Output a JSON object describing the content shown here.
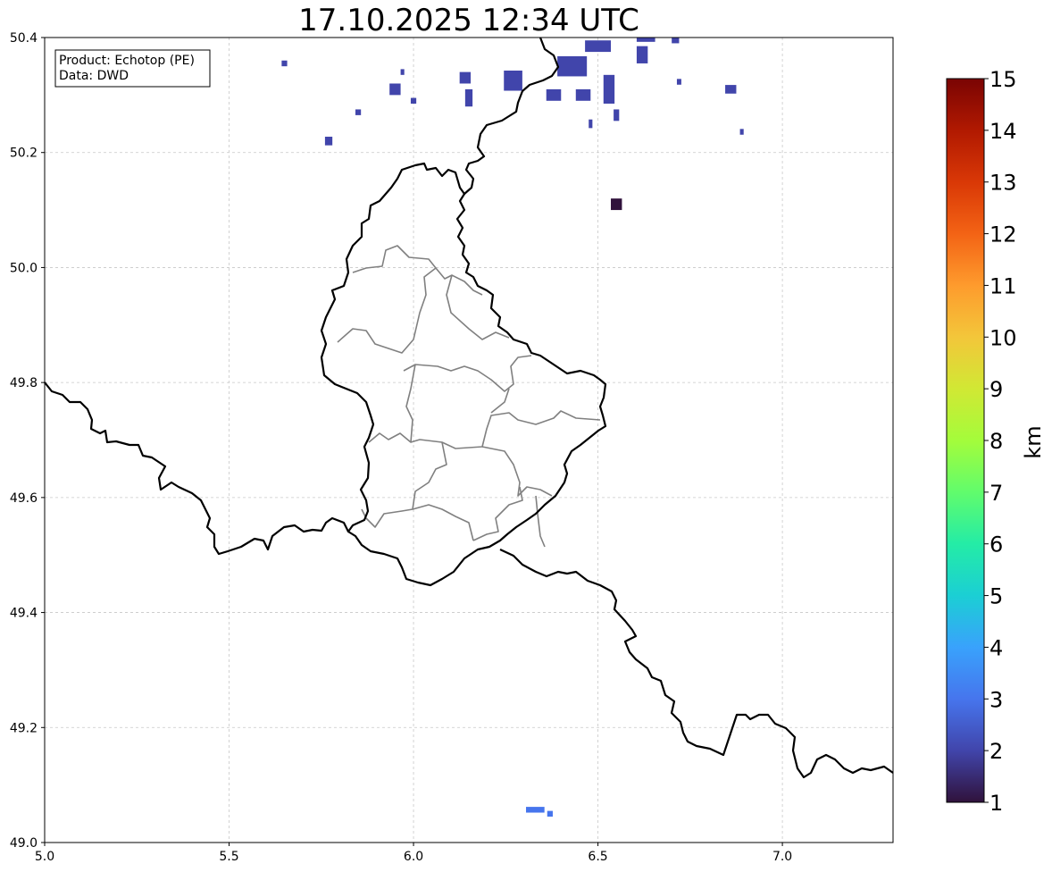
{
  "title": "17.10.2025 12:34 UTC",
  "info_box": {
    "product_line": "Product: Echotop (PE)",
    "data_line": "Data: DWD"
  },
  "map": {
    "lon_range": [
      5.0,
      7.3
    ],
    "lat_range": [
      49.0,
      50.4
    ],
    "x_ticks": [
      {
        "value": 5.0,
        "label": "5.0"
      },
      {
        "value": 5.5,
        "label": "5.5"
      },
      {
        "value": 6.0,
        "label": "6.0"
      },
      {
        "value": 6.5,
        "label": "6.5"
      },
      {
        "value": 7.0,
        "label": "7.0"
      }
    ],
    "y_ticks": [
      {
        "value": 49.0,
        "label": "49.0"
      },
      {
        "value": 49.2,
        "label": "49.2"
      },
      {
        "value": 49.4,
        "label": "49.4"
      },
      {
        "value": 49.6,
        "label": "49.6"
      },
      {
        "value": 49.8,
        "label": "49.8"
      },
      {
        "value": 50.0,
        "label": "50.0"
      },
      {
        "value": 50.2,
        "label": "50.2"
      },
      {
        "value": 50.4,
        "label": "50.4"
      }
    ],
    "grid": true,
    "colors": {
      "border": "#000000",
      "districts": "#808080",
      "grid": "#c8c8c8"
    },
    "radar_cells": [
      {
        "lon": 5.65,
        "lat": 50.355,
        "w": 0.015,
        "h": 0.01,
        "km": 2.3
      },
      {
        "lon": 5.77,
        "lat": 50.22,
        "w": 0.02,
        "h": 0.015,
        "km": 2.2
      },
      {
        "lon": 5.85,
        "lat": 50.27,
        "w": 0.015,
        "h": 0.01,
        "km": 2.2
      },
      {
        "lon": 5.95,
        "lat": 50.31,
        "w": 0.03,
        "h": 0.02,
        "km": 2.2
      },
      {
        "lon": 5.97,
        "lat": 50.34,
        "w": 0.01,
        "h": 0.01,
        "km": 2.0
      },
      {
        "lon": 6.0,
        "lat": 50.29,
        "w": 0.015,
        "h": 0.01,
        "km": 2.3
      },
      {
        "lon": 6.14,
        "lat": 50.33,
        "w": 0.03,
        "h": 0.02,
        "km": 2.1
      },
      {
        "lon": 6.15,
        "lat": 50.295,
        "w": 0.02,
        "h": 0.03,
        "km": 1.6
      },
      {
        "lon": 6.27,
        "lat": 50.325,
        "w": 0.05,
        "h": 0.035,
        "km": 2.2
      },
      {
        "lon": 6.38,
        "lat": 50.3,
        "w": 0.04,
        "h": 0.02,
        "km": 2.2
      },
      {
        "lon": 6.43,
        "lat": 50.35,
        "w": 0.08,
        "h": 0.035,
        "km": 1.8
      },
      {
        "lon": 6.5,
        "lat": 50.385,
        "w": 0.07,
        "h": 0.02,
        "km": 2.1
      },
      {
        "lon": 6.53,
        "lat": 50.31,
        "w": 0.03,
        "h": 0.05,
        "km": 2.2
      },
      {
        "lon": 6.46,
        "lat": 50.3,
        "w": 0.04,
        "h": 0.02,
        "km": 2.2
      },
      {
        "lon": 6.55,
        "lat": 50.265,
        "w": 0.015,
        "h": 0.02,
        "km": 2.4
      },
      {
        "lon": 6.48,
        "lat": 50.25,
        "w": 0.01,
        "h": 0.015,
        "km": 2.2
      },
      {
        "lon": 6.62,
        "lat": 50.37,
        "w": 0.03,
        "h": 0.03,
        "km": 2.2
      },
      {
        "lon": 6.63,
        "lat": 50.4,
        "w": 0.05,
        "h": 0.015,
        "km": 2.2
      },
      {
        "lon": 6.71,
        "lat": 50.395,
        "w": 0.02,
        "h": 0.01,
        "km": 2.2
      },
      {
        "lon": 6.72,
        "lat": 50.323,
        "w": 0.012,
        "h": 0.01,
        "km": 2.0
      },
      {
        "lon": 6.86,
        "lat": 50.31,
        "w": 0.03,
        "h": 0.015,
        "km": 2.2
      },
      {
        "lon": 6.89,
        "lat": 50.236,
        "w": 0.01,
        "h": 0.01,
        "km": 2.2
      },
      {
        "lon": 6.55,
        "lat": 50.11,
        "w": 0.03,
        "h": 0.02,
        "km": 1.3
      },
      {
        "lon": 6.33,
        "lat": 49.057,
        "w": 0.05,
        "h": 0.01,
        "km": 3.4
      },
      {
        "lon": 6.37,
        "lat": 49.05,
        "w": 0.015,
        "h": 0.01,
        "km": 3.4
      }
    ]
  },
  "colorbar": {
    "label": "km",
    "min": 1,
    "max": 15,
    "ticks": [
      "1",
      "2",
      "3",
      "4",
      "5",
      "6",
      "7",
      "8",
      "9",
      "10",
      "11",
      "12",
      "13",
      "14",
      "15"
    ],
    "colormap": [
      "#30123b",
      "#4145ab",
      "#4675ed",
      "#39a2fc",
      "#1bcfd4",
      "#24eca6",
      "#61fc6c",
      "#a4fc3b",
      "#d1e834",
      "#f3c63a",
      "#fe9b2d",
      "#f36315",
      "#d93806",
      "#b11901",
      "#7a0403"
    ]
  }
}
